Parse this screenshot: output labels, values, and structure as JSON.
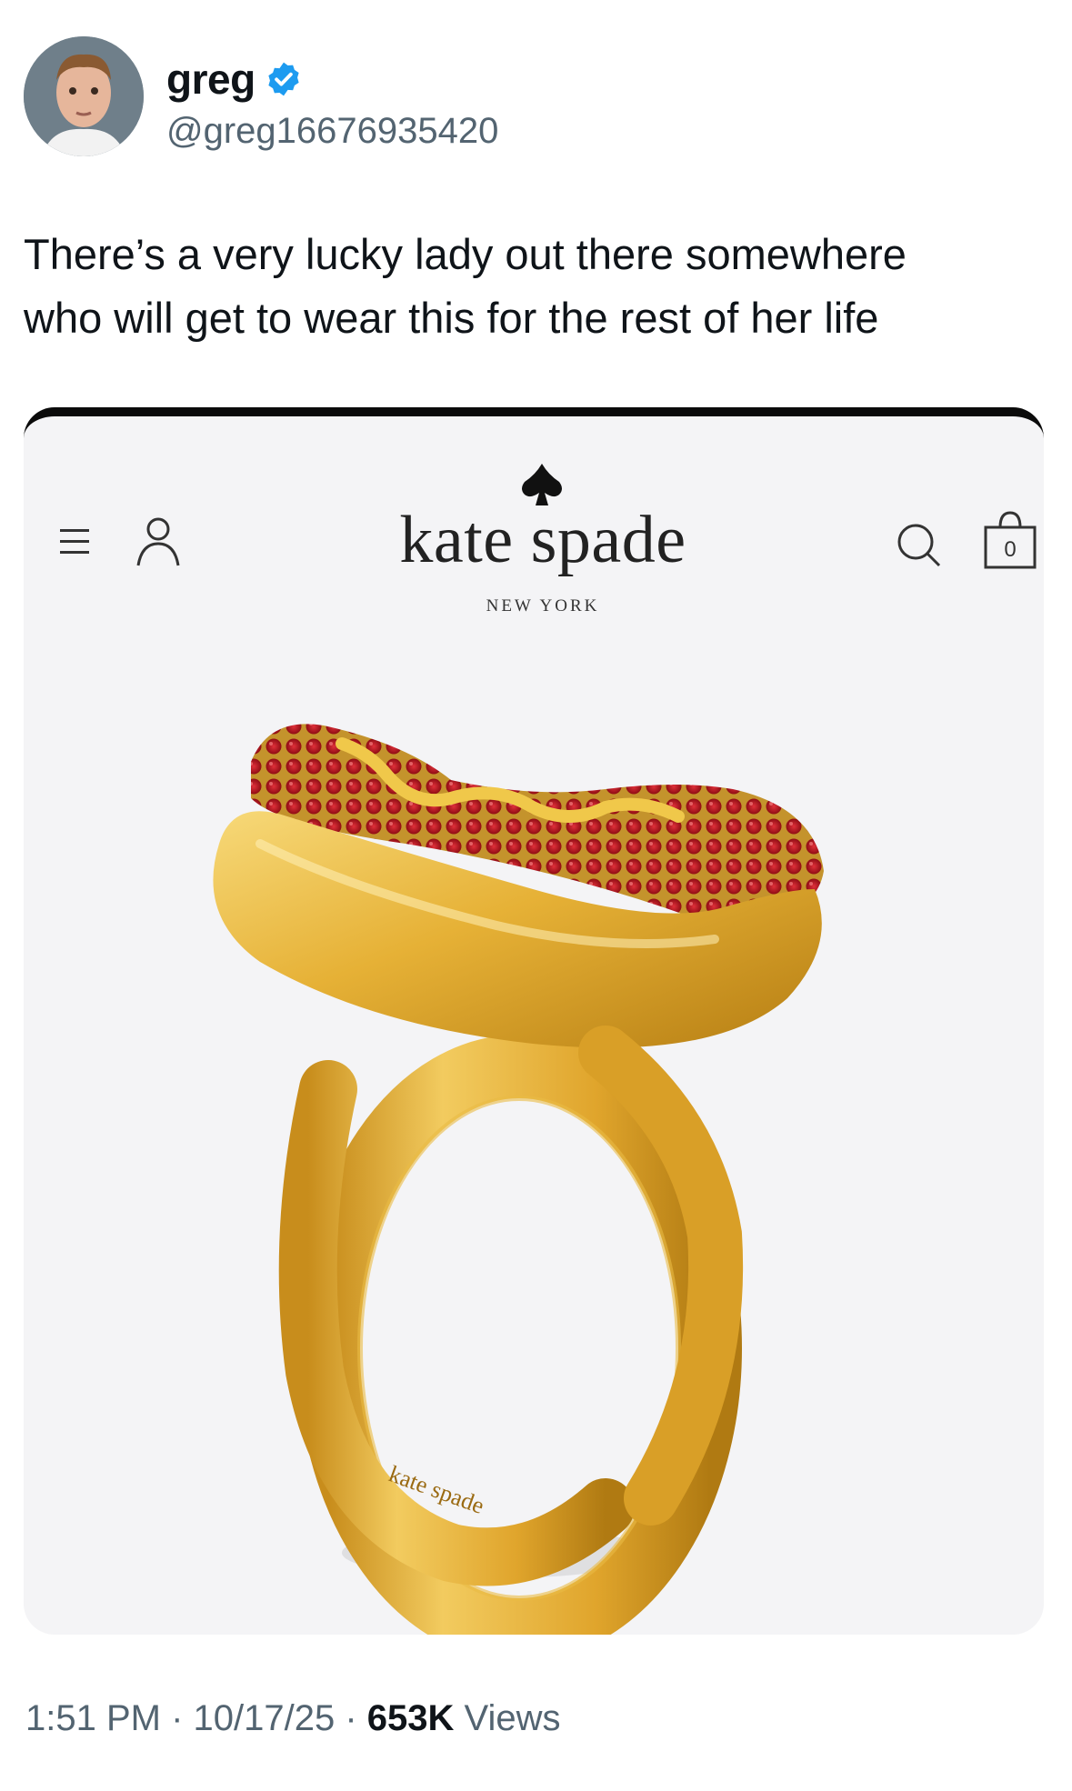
{
  "tweet": {
    "author_name": "greg",
    "author_handle": "@greg16676935420",
    "text_line_1": "There’s a very lucky lady out there somewhere",
    "text_line_2": "who will get to wear this for the rest of her life",
    "time": "1:51 PM",
    "date": "10/17/25",
    "separator": " · ",
    "views_count": "653K",
    "views_label": "Views"
  },
  "media": {
    "brand_name": "kate spade",
    "brand_location": "NEW YORK",
    "ring_engraving": "kate spade",
    "bag_count": "0",
    "icons": [
      "menu-icon",
      "user-icon",
      "spade-logo-icon",
      "search-icon",
      "shopping-bag-icon"
    ]
  },
  "colors": {
    "verified_blue": "#1d9bf0",
    "secondary_text": "#536471",
    "gold": "#e2ad2e",
    "crystal_red": "#b3121c"
  }
}
